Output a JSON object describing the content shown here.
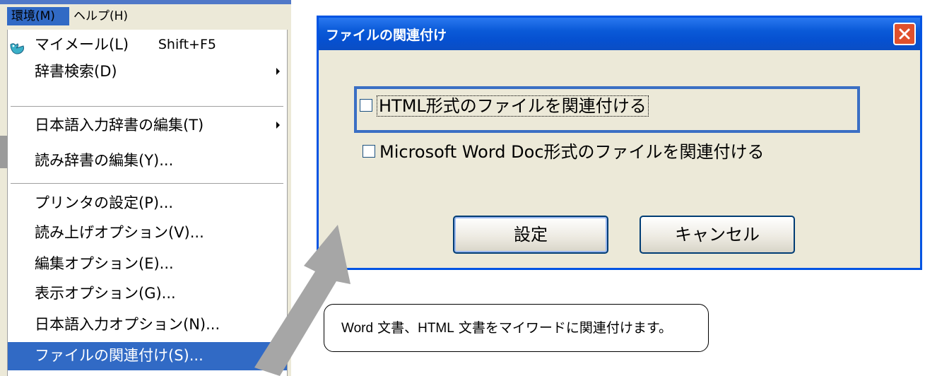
{
  "menubar": {
    "env": "環境(M)",
    "help": "ヘルプ(H)"
  },
  "menu": {
    "items": [
      {
        "label": "マイメール(L)",
        "shortcut": "Shift+F5",
        "icon": "mail-icon"
      },
      {
        "label": "辞書検索(D)",
        "submenu": true
      },
      {
        "label": "日本語入力辞書の編集(T)",
        "submenu": true
      },
      {
        "label": "読み辞書の編集(Y)..."
      },
      {
        "label": "プリンタの設定(P)..."
      },
      {
        "label": "読み上げオプション(V)..."
      },
      {
        "label": "編集オプション(E)..."
      },
      {
        "label": "表示オプション(G)..."
      },
      {
        "label": "日本語入力オプション(N)..."
      },
      {
        "label": "ファイルの関連付け(S)...",
        "highlighted": true
      }
    ]
  },
  "dialog": {
    "title": "ファイルの関連付け",
    "checkbox_html": "HTML形式のファイルを関連付ける",
    "checkbox_word": "Microsoft Word Doc形式のファイルを関連付ける",
    "ok": "設定",
    "cancel": "キャンセル"
  },
  "callout": {
    "text_a": "Word",
    "text_b": " 文書、",
    "text_c": "HTML",
    "text_d": " 文書をマイワードに関連付けます。"
  },
  "colors": {
    "titlebar": "#0a5ad8",
    "highlight": "#316ac5",
    "dialog_bg": "#ece9d8",
    "arrow": "#a6a6a6"
  }
}
